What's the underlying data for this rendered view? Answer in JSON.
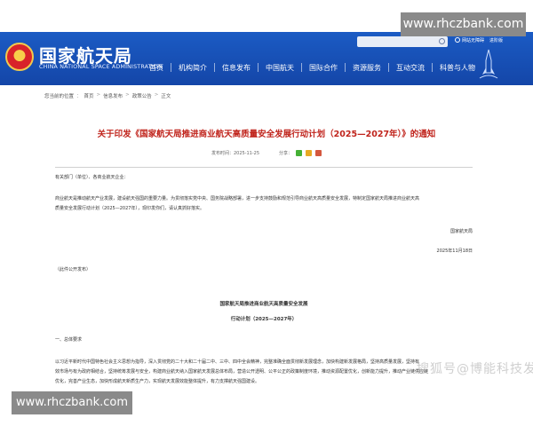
{
  "watermark": {
    "top": "www.rhczbank.com",
    "bottom": "www.rhczbank.com",
    "faint": "搜狐号@博能科技发展"
  },
  "header": {
    "logo_cn": "国家航天局",
    "logo_en": "CHINA NATIONAL SPACE ADMINISTRATION",
    "top_links": [
      "网站无障碍",
      "进阶版"
    ],
    "nav": [
      "首页",
      "机构简介",
      "信息发布",
      "中国航天",
      "国际合作",
      "资源服务",
      "互动交流",
      "科普与人物"
    ]
  },
  "breadcrumb": {
    "label": "您当前的位置",
    "items": [
      "首页",
      "信息发布",
      "政策公告",
      "正文"
    ]
  },
  "article": {
    "title": "关于印发《国家航天局推进商业航天高质量安全发展行动计划（2025—2027年）》的通知",
    "meta_date": "发布时间：2025-11-25",
    "meta_share_label": "分享：",
    "salutation": "有关部门（单位）、各商业航天企业：",
    "body_line1": "商业航天是推动航天产业发展，建设航天强国的重要力量。为贯彻落实党中央、国务院战略部署，进一步支持鼓励和规范引导商业航天高质量安全发展，特制定国家航天局推进商业航天高",
    "body_line2": "质量安全发展行动计划（2025—2027年），现印发你们，请认真抓好落实。",
    "signature": "国家航天局",
    "date": "2025年11月18日",
    "disclosure": "（此件公开发布）",
    "doc_title": "国家航天局推进商业航天高质量安全发展",
    "doc_subtitle": "行动计划（2025—2027年）",
    "section1": "一、总体要求",
    "para1": "以习近平新时代中国特色社会主义思想为指导，深入贯彻党的二十大和二十届二中、三中、四中全会精神，完整准确全面贯彻新发展理念，加快构建新发展格局，坚持高质量发展，坚持有",
    "para2": "效市场与有为政府相结合，坚持统筹发展与安全，构建商业航天纳入国家航天发展总体布局，营造公开透明、公平公正的政策制度环境，推动资源配置优化，创新能力提升，推动产业链供应链",
    "para3": "优化，完善产业生态，加快形成航天新质生产力，实现航天发展效能整体提升，有力支撑航天强国建设。"
  }
}
